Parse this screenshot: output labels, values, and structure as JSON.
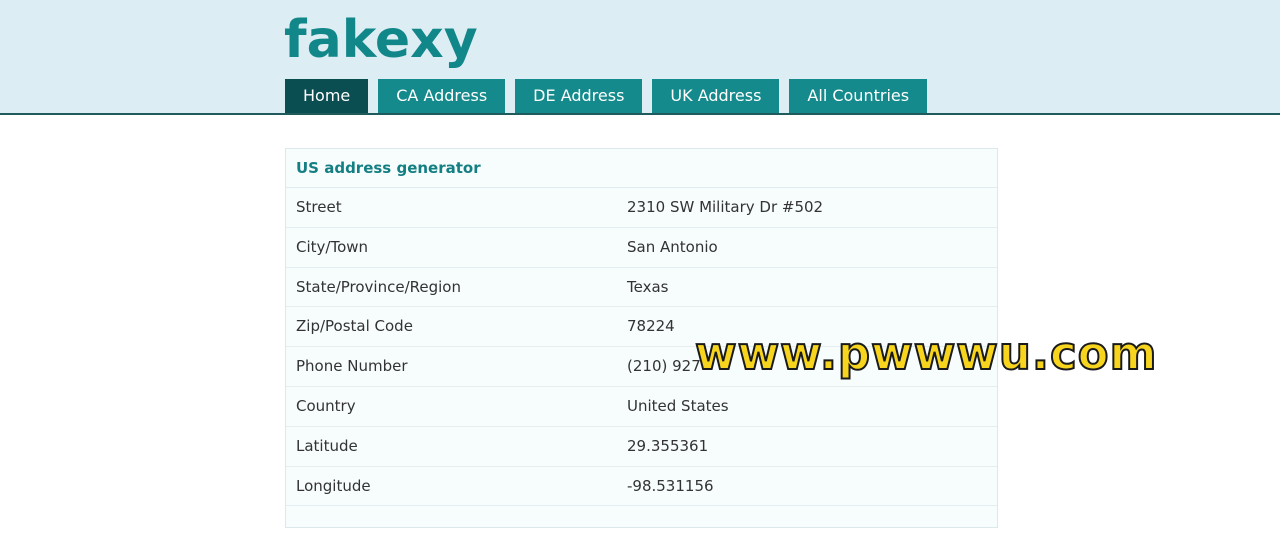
{
  "site": {
    "logo": "fakexy"
  },
  "nav": {
    "items": [
      {
        "label": "Home",
        "active": true
      },
      {
        "label": "CA Address",
        "active": false
      },
      {
        "label": "DE Address",
        "active": false
      },
      {
        "label": "UK Address",
        "active": false
      },
      {
        "label": "All Countries",
        "active": false
      }
    ]
  },
  "card": {
    "title": "US address generator",
    "rows": [
      {
        "label": "Street",
        "value": "2310 SW Military Dr #502"
      },
      {
        "label": "City/Town",
        "value": "San Antonio"
      },
      {
        "label": "State/Province/Region",
        "value": "Texas"
      },
      {
        "label": "Zip/Postal Code",
        "value": "78224"
      },
      {
        "label": "Phone Number",
        "value": "(210) 927-"
      },
      {
        "label": "Country",
        "value": "United States"
      },
      {
        "label": "Latitude",
        "value": "29.355361"
      },
      {
        "label": "Longitude",
        "value": "-98.531156"
      }
    ]
  },
  "watermark": "www.pwwwu.com",
  "colors": {
    "header_bg": "#dcedf3",
    "accent": "#148a8c",
    "nav_active": "#0b4e51",
    "watermark": "#f7d51e"
  }
}
